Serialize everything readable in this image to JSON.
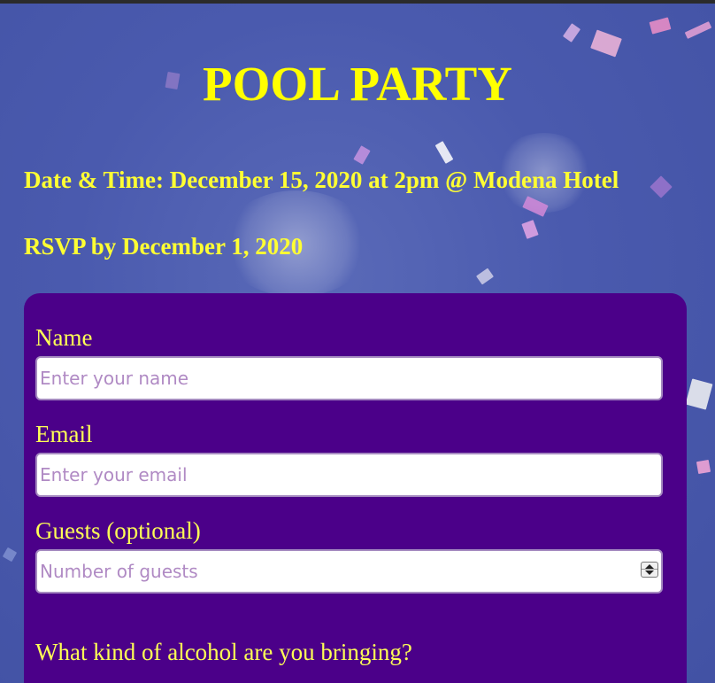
{
  "event": {
    "title": "POOL PARTY",
    "date_line": "Date & Time: December 15, 2020 at 2pm @ Modena Hotel",
    "rsvp_line": "RSVP by December 1, 2020"
  },
  "form": {
    "name": {
      "label": "Name",
      "placeholder": "Enter your name",
      "value": ""
    },
    "email": {
      "label": "Email",
      "placeholder": "Enter your email",
      "value": ""
    },
    "guests": {
      "label": "Guests (optional)",
      "placeholder": "Number of guests",
      "value": ""
    },
    "alcohol_question": "What kind of alcohol are you bringing?"
  },
  "colors": {
    "background": "#4a5aae",
    "heading_yellow": "#ffff00",
    "form_background": "#4b0089",
    "placeholder": "#b08ac4"
  },
  "icons": {
    "spinner": "number-spinner-icon"
  }
}
